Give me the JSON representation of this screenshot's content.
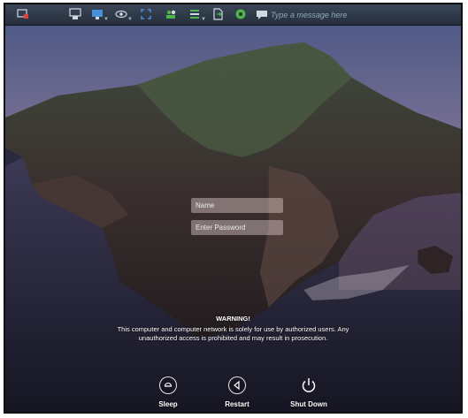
{
  "toolbar": {
    "icons": [
      "remote-screen-icon",
      "transfer-icon",
      "monitor-icon",
      "view-icon",
      "fullscreen-icon",
      "users-icon",
      "panel-icon",
      "file-transfer-icon",
      "record-icon",
      "chat-icon"
    ],
    "message_placeholder": "Type a message here",
    "accent_colors": {
      "red": "#e0413b",
      "green": "#4fb54a",
      "blue": "#4a90d9"
    }
  },
  "login": {
    "name_placeholder": "Name",
    "password_placeholder": "Enter Password"
  },
  "warning": {
    "title": "WARNING!",
    "line1": "This computer and computer network is solely for use by authorized users. Any",
    "line2": "unauthorized access is prohibited and may result in prosecution."
  },
  "actions": {
    "sleep": "Sleep",
    "restart": "Restart",
    "shutdown": "Shut Down"
  }
}
